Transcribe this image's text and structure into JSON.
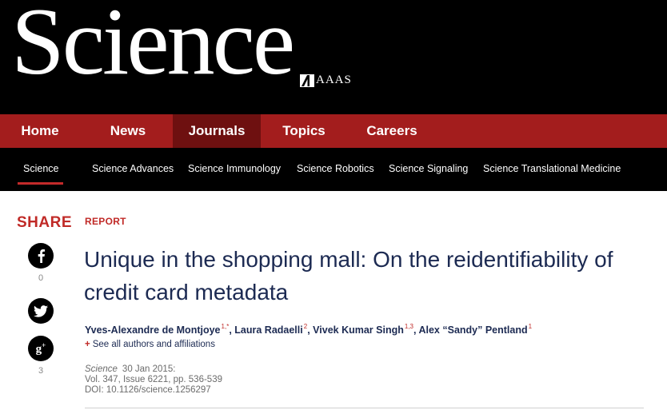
{
  "masthead": {
    "logo_text": "Science",
    "publisher": "AAAS"
  },
  "main_nav": {
    "items": [
      "Home",
      "News",
      "Journals",
      "Topics",
      "Careers"
    ],
    "active": "Journals"
  },
  "journal_nav": {
    "items": [
      "Science",
      "Science Advances",
      "Science Immunology",
      "Science Robotics",
      "Science Signaling",
      "Science Translational Medicine"
    ],
    "active": "Science"
  },
  "share": {
    "label": "SHARE",
    "facebook_count": "0",
    "googleplus_count": "3",
    "icons": [
      "facebook-icon",
      "twitter-icon",
      "googleplus-icon"
    ]
  },
  "article": {
    "type_label": "REPORT",
    "title": "Unique in the shopping mall: On the reidentifiability of credit card metadata",
    "authors": [
      {
        "name": "Yves-Alexandre de Montjoye",
        "sup": "1,*",
        "sep": ","
      },
      {
        "name": "Laura Radaelli",
        "sup": "2",
        "sep": ","
      },
      {
        "name": "Vivek Kumar Singh",
        "sup": "1,3",
        "sep": ","
      },
      {
        "name": "Alex “Sandy” Pentland",
        "sup": "1",
        "sep": ""
      }
    ],
    "see_all_plus": "+",
    "see_all_label": "See all authors and affiliations",
    "citation": {
      "journal": "Science",
      "date": "30 Jan 2015:",
      "volume_line": "Vol. 347, Issue 6221, pp. 536-539",
      "doi_line": "DOI: 10.1126/science.1256297"
    }
  },
  "colors": {
    "nav_red": "#a31d1d",
    "nav_active": "#6e1010",
    "accent_red": "#c02a27",
    "title_navy": "#1c2a52",
    "masthead_black": "#000000"
  }
}
